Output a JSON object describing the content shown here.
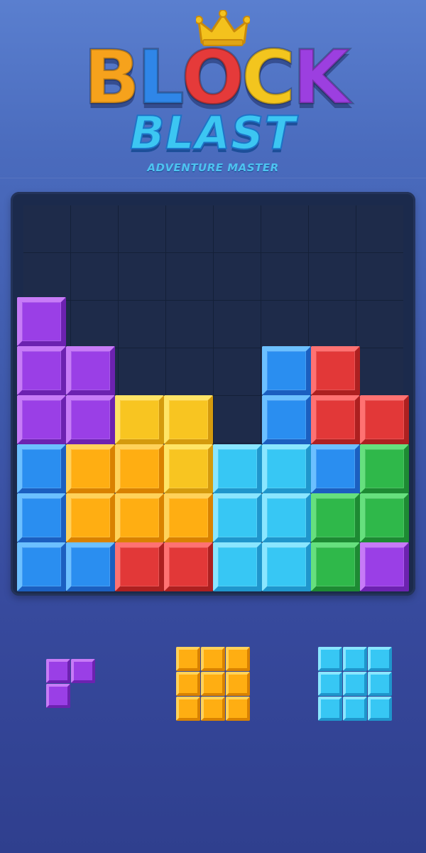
{
  "logo": {
    "word1": "BLOCK",
    "word1_letters": [
      {
        "ch": "B",
        "color": "#f6a21c"
      },
      {
        "ch": "L",
        "color": "#2f86e8"
      },
      {
        "ch": "O",
        "color": "#e53a3a"
      },
      {
        "ch": "C",
        "color": "#f3c51e"
      },
      {
        "ch": "K",
        "color": "#9c3fe0"
      }
    ],
    "word2": "BLAST",
    "tagline": "ADVENTURE MASTER",
    "crown_color": "#f4c21d"
  },
  "palette": {
    "purple": {
      "base": "#9a3fe6",
      "light": "#c77bf7",
      "dark": "#6c22b0"
    },
    "blue": {
      "base": "#2a8ef0",
      "light": "#6cc0ff",
      "dark": "#1b5fc0"
    },
    "cyan": {
      "base": "#37c7f4",
      "light": "#8ae6ff",
      "dark": "#1f96cc"
    },
    "red": {
      "base": "#e23838",
      "light": "#ff7272",
      "dark": "#ad2020"
    },
    "orange": {
      "base": "#ffae12",
      "light": "#ffd25a",
      "dark": "#d98200"
    },
    "yellow": {
      "base": "#f8c521",
      "light": "#ffe466",
      "dark": "#d49a0d"
    },
    "green": {
      "base": "#2fb84a",
      "light": "#66e07e",
      "dark": "#1d8a33"
    }
  },
  "board": {
    "columns": 8,
    "rows": 8,
    "cells": [
      [
        null,
        null,
        null,
        null,
        null,
        null,
        null,
        null
      ],
      [
        null,
        null,
        null,
        null,
        null,
        null,
        null,
        null
      ],
      [
        "purple",
        null,
        null,
        null,
        null,
        null,
        null,
        null
      ],
      [
        "purple",
        "purple",
        null,
        null,
        null,
        "blue",
        "red",
        null
      ],
      [
        "purple",
        "purple",
        "yellow",
        "yellow",
        null,
        "blue",
        "red",
        "red"
      ],
      [
        "blue",
        "orange",
        "orange",
        "yellow",
        "cyan",
        "cyan",
        "blue",
        "green"
      ],
      [
        "blue",
        "orange",
        "orange",
        "orange",
        "cyan",
        "cyan",
        "green",
        "green"
      ],
      [
        "blue",
        "blue",
        "red",
        "red",
        "cyan",
        "cyan",
        "green",
        "purple"
      ]
    ]
  },
  "tray": {
    "pieces": [
      {
        "name": "purple-corner-piece",
        "color": "purple",
        "shape": [
          [
            1,
            1
          ],
          [
            1,
            0
          ]
        ]
      },
      {
        "name": "orange-3x3-piece",
        "color": "orange",
        "shape": [
          [
            1,
            1,
            1
          ],
          [
            1,
            1,
            1
          ],
          [
            1,
            1,
            1
          ]
        ]
      },
      {
        "name": "cyan-3x3-piece",
        "color": "cyan",
        "shape": [
          [
            1,
            1,
            1
          ],
          [
            1,
            1,
            1
          ],
          [
            1,
            1,
            1
          ]
        ]
      }
    ]
  }
}
